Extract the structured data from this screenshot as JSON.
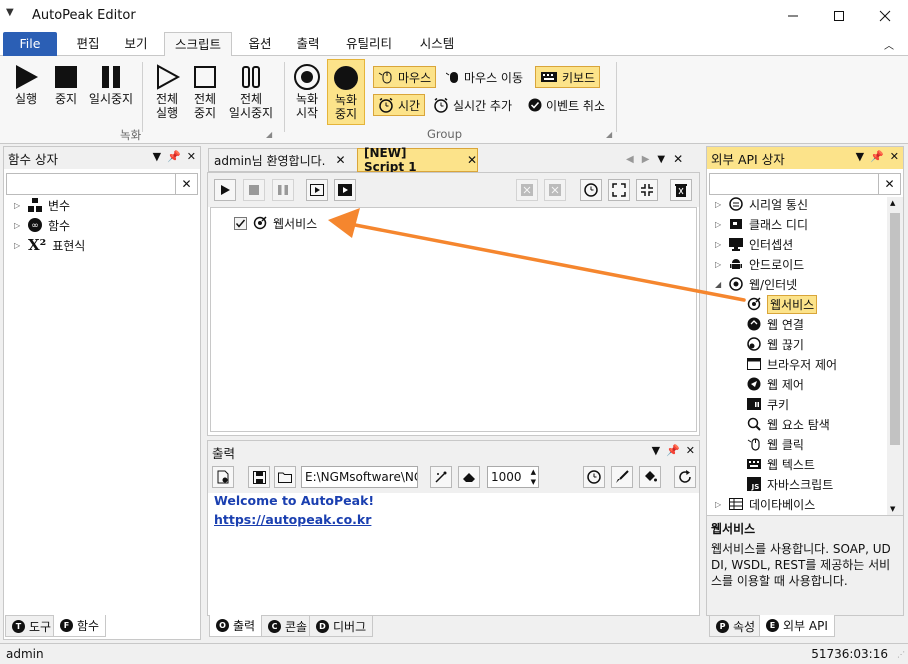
{
  "app": {
    "title": "AutoPeak Editor"
  },
  "menu": [
    {
      "label": "File"
    },
    {
      "label": "편집"
    },
    {
      "label": "보기"
    },
    {
      "label": "스크립트"
    },
    {
      "label": "옵션"
    },
    {
      "label": "출력"
    },
    {
      "label": "유틸리티"
    },
    {
      "label": "시스템"
    }
  ],
  "ribbon": {
    "run": "실행",
    "stop": "중지",
    "pause": "일시중지",
    "all_run": [
      "전체",
      "실행"
    ],
    "all_stop": [
      "전체",
      "중지"
    ],
    "all_pause": [
      "전체",
      "일시중지"
    ],
    "rec_start": [
      "녹화",
      "시작"
    ],
    "rec_stop": [
      "녹화",
      "중지"
    ],
    "group_rec": "녹화",
    "group_group": "Group",
    "mouse_click": "마우스",
    "mouse_move": "마우스 이동",
    "keyboard": "키보드",
    "time": "시간",
    "realtime_add": "실시간 추가",
    "event_cancel": "이벤트 취소"
  },
  "left_panel": {
    "title": "함수 상자",
    "search_value": "",
    "items": [
      {
        "label": "변수"
      },
      {
        "label": "함수"
      },
      {
        "label": "표현식"
      }
    ],
    "tabs": [
      {
        "label": "도구",
        "icon": "T"
      },
      {
        "label": "함수",
        "icon": "F"
      }
    ]
  },
  "editor": {
    "tabs": [
      {
        "label": "admin님 환영합니다."
      },
      {
        "label": "[NEW] Script 1"
      }
    ],
    "script_item": "웹서비스",
    "checked": true
  },
  "output": {
    "title": "출력",
    "path": "E:\\NGMsoftware\\NG",
    "number": "1000",
    "lines": [
      "Welcome to AutoPeak!",
      "https://autopeak.co.kr"
    ],
    "tabs": [
      {
        "label": "출력",
        "icon": "O"
      },
      {
        "label": "콘솔",
        "icon": "C"
      },
      {
        "label": "디버그",
        "icon": "D"
      }
    ]
  },
  "right_panel": {
    "title": "외부 API 상자",
    "search_value": "",
    "items": [
      {
        "label": "시리얼 통신",
        "icon": "serial-icon"
      },
      {
        "label": "클래스 디디",
        "icon": "class-icon"
      },
      {
        "label": "인터셉션",
        "icon": "monitor-icon"
      },
      {
        "label": "안드로이드",
        "icon": "android-icon"
      },
      {
        "label": "웹/인터넷",
        "icon": "globe-icon"
      },
      {
        "label": "웹서비스",
        "icon": "webservice-icon"
      },
      {
        "label": "웹 연결",
        "icon": "web-connect-icon"
      },
      {
        "label": "웹 끊기",
        "icon": "web-disconnect-icon"
      },
      {
        "label": "브라우저 제어",
        "icon": "browser-icon"
      },
      {
        "label": "웹 제어",
        "icon": "navigation-icon"
      },
      {
        "label": "쿠키",
        "icon": "cookie-icon"
      },
      {
        "label": "웹 요소 탐색",
        "icon": "search-element-icon"
      },
      {
        "label": "웹 클릭",
        "icon": "mouse-click-icon"
      },
      {
        "label": "웹 텍스트",
        "icon": "keyboard-icon"
      },
      {
        "label": "자바스크립트",
        "icon": "js-icon"
      },
      {
        "label": "데이타베이스",
        "icon": "database-icon"
      }
    ],
    "desc_title": "웹서비스",
    "desc_text": "웹서비스를 사용합니다. SOAP, UDDI, WSDL, REST를 제공하는 서비스를 이용할 때 사용합니다.",
    "tabs": [
      {
        "label": "속성",
        "icon": "P"
      },
      {
        "label": "외부 API",
        "icon": "E"
      }
    ]
  },
  "status": {
    "user": "admin",
    "timer": "51736:03:16"
  },
  "colors": {
    "accent": "#2b5fb5",
    "highlight": "#fce38a",
    "arrow": "#f5862e",
    "link": "#1a3fb0"
  }
}
